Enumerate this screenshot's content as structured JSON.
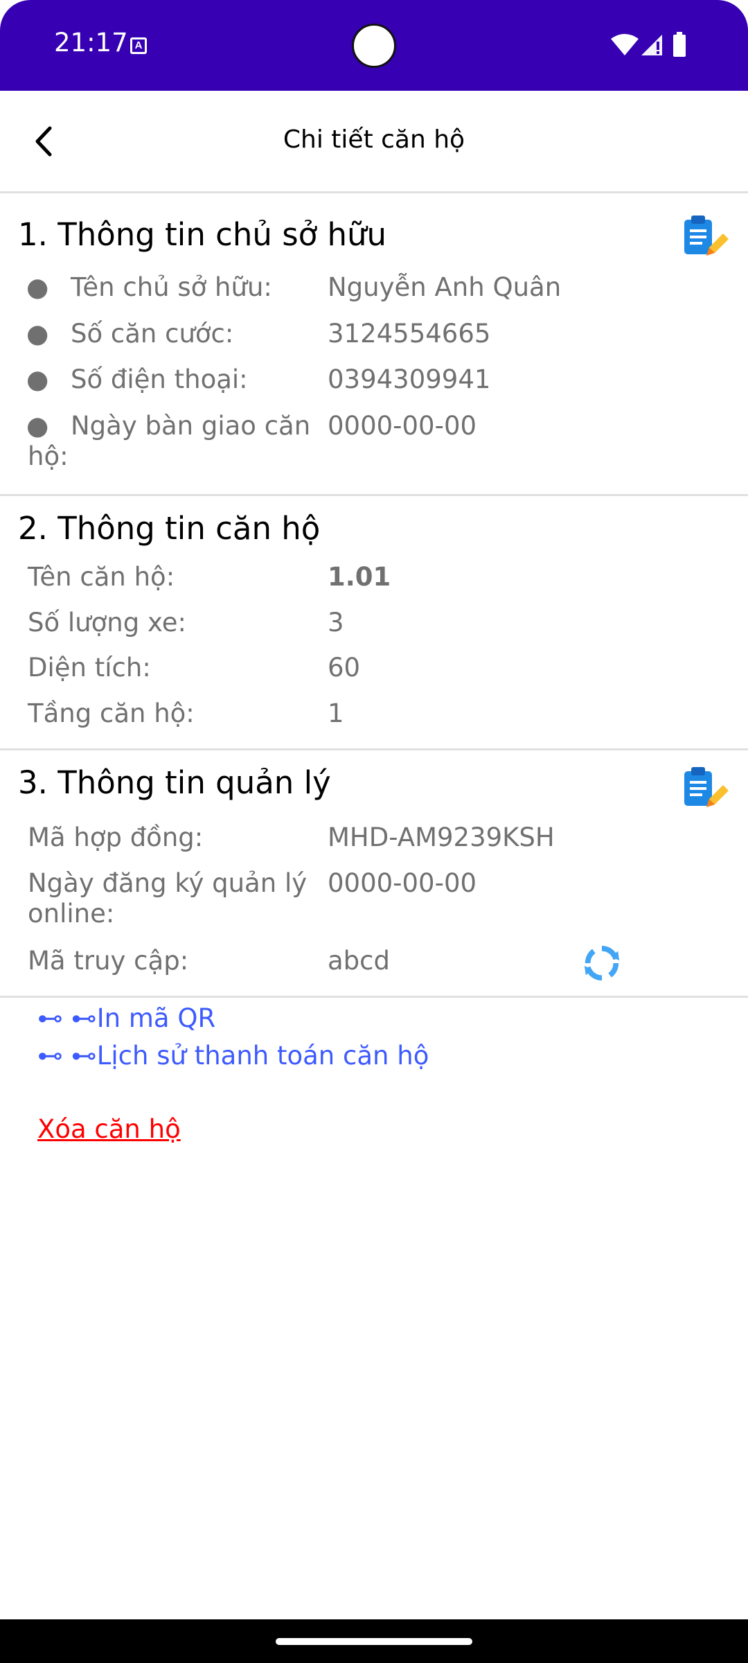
{
  "status_bar": {
    "time": "21:17",
    "notification_icon_letter": "A"
  },
  "app_bar": {
    "title": "Chi tiết căn hộ",
    "back_icon": "arrow-back-icon"
  },
  "owner_section": {
    "title": "1. Thông tin chủ sở hữu",
    "bullet": "●",
    "rows": [
      {
        "label": "Tên chủ sở hữu:",
        "value": "Nguyễn Anh Quân"
      },
      {
        "label": "Số căn cước:",
        "value": "3124554665"
      },
      {
        "label": "Số điện thoại:",
        "value": "0394309941"
      },
      {
        "label_line1": "Ngày bàn giao căn",
        "label_line2": "hộ:",
        "value": "0000-00-00"
      }
    ],
    "edit_icon": "clipboard-edit-icon"
  },
  "apartment_section": {
    "title": "2. Thông tin căn hộ",
    "rows": [
      {
        "label": "Tên căn hộ:",
        "value": "1.01"
      },
      {
        "label": "Số lượng xe:",
        "value": "3"
      },
      {
        "label": "Diện tích:",
        "value": "60"
      },
      {
        "label": "Tầng căn hộ:",
        "value": "1"
      }
    ]
  },
  "management_section": {
    "title": "3. Thông tin quản lý",
    "rows": [
      {
        "label": "Mã hợp đồng:",
        "value": "MHD-AM9239KSH"
      },
      {
        "label_line1": "Ngày đăng ký quản lý",
        "label_line2": "online:",
        "value": "0000-00-00"
      },
      {
        "label": "Mã truy cập:",
        "value": "abcd"
      }
    ],
    "edit_icon": "clipboard-edit-icon",
    "refresh_icon": "refresh-icon"
  },
  "links": {
    "print_qr": "⊷ ⊷In mã QR",
    "payment_history": "⊷ ⊷Lịch sử thanh toán căn hộ",
    "delete": "Xóa căn hộ"
  },
  "colors": {
    "status_bar": "#3700B3",
    "link": "#3D5AFE",
    "delete": "#FF0000",
    "edit_icon": "#1E88E5",
    "refresh_icon": "#42A5F5"
  }
}
